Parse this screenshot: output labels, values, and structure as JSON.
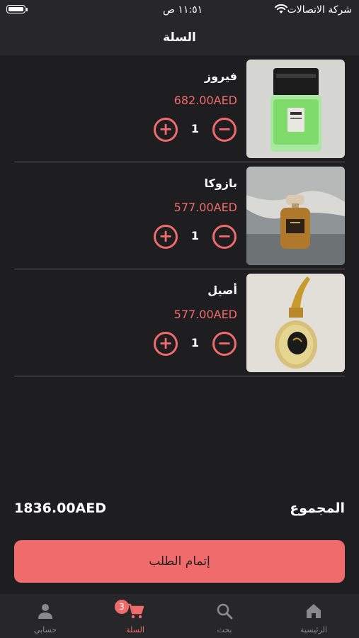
{
  "status_bar": {
    "time": "١١:٥١ ص",
    "carrier": "شركة الاتصالات"
  },
  "header": {
    "title": "السلة"
  },
  "cart": {
    "items": [
      {
        "name": "فيروز",
        "price": "682.00AED",
        "quantity": "1",
        "image": "green-perfume-bottle"
      },
      {
        "name": "بازوكا",
        "price": "577.00AED",
        "quantity": "1",
        "image": "amber-perfume-bottle-beach"
      },
      {
        "name": "أصيل",
        "price": "577.00AED",
        "quantity": "1",
        "image": "gold-crest-perfume-bottle"
      }
    ],
    "plus_symbol": "+",
    "minus_symbol": "−"
  },
  "summary": {
    "total_label": "المجموع",
    "total_value": "1836.00AED"
  },
  "checkout": {
    "label": "إتمام الطلب"
  },
  "tab_bar": {
    "tabs": [
      {
        "label": "حسابي",
        "icon": "user-icon"
      },
      {
        "label": "السلة",
        "icon": "cart-icon",
        "badge": "3"
      },
      {
        "label": "بحث",
        "icon": "search-icon"
      },
      {
        "label": "الرئيسية",
        "icon": "home-icon"
      }
    ]
  },
  "colors": {
    "accent": "#f06b6b",
    "background": "#1e1e20",
    "bar": "#27272a"
  }
}
